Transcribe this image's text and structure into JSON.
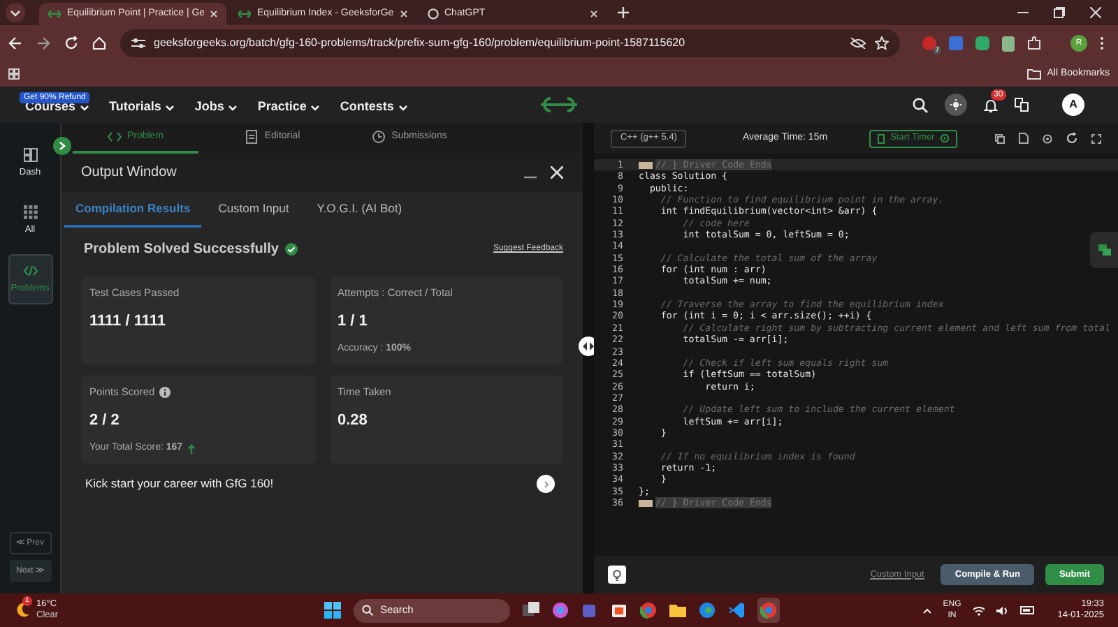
{
  "browser": {
    "tabs": [
      {
        "label": "Equilibrium Point | Practice | Ge",
        "selected": true
      },
      {
        "label": "Equilibrium Index - GeeksforGe",
        "selected": false
      },
      {
        "label": "ChatGPT",
        "selected": false
      }
    ],
    "url": "geeksforgeeks.org/batch/gfg-160-problems/track/prefix-sum-gfg-160/problem/equilibrium-point-1587115620",
    "extension_badge": "7",
    "profile_initial": "R",
    "bookmarks_label": "All Bookmarks"
  },
  "site_nav": {
    "promo_badge": "Get 90% Refund",
    "items": [
      "Courses",
      "Tutorials",
      "Jobs",
      "Practice",
      "Contests"
    ],
    "notification_count": "30",
    "avatar_initial": "A"
  },
  "sidebar": {
    "items": [
      {
        "label": "Dash",
        "selected": false
      },
      {
        "label": "All",
        "selected": false
      },
      {
        "label": "Problems",
        "selected": true
      }
    ],
    "prev": "≪ Prev",
    "next": "Next ≫"
  },
  "problem_tabs": [
    {
      "label": "Problem",
      "selected": true
    },
    {
      "label": "Editorial",
      "selected": false
    },
    {
      "label": "Submissions",
      "selected": false
    }
  ],
  "output_window": {
    "title": "Output Window",
    "tabs": [
      {
        "label": "Compilation Results",
        "selected": true
      },
      {
        "label": "Custom Input",
        "selected": false
      },
      {
        "label": "Y.O.G.I. (AI Bot)",
        "selected": false
      }
    ],
    "status": "Problem Solved Successfully",
    "feedback_link": "Suggest Feedback",
    "cards": [
      {
        "title": "Test Cases Passed",
        "value": "1111 / 1111"
      },
      {
        "title": "Attempts : Correct / Total",
        "value": "1 / 1",
        "note": "Accuracy : **100%**"
      },
      {
        "title": "Points Scored",
        "value": "2 / 2",
        "note": "Your Total Score: **167**",
        "info": true,
        "trend_up": true
      },
      {
        "title": "Time Taken",
        "value": "0.28"
      }
    ],
    "promo": "Kick start your career with GfG 160!"
  },
  "editor": {
    "language": "C++ (g++ 5.4)",
    "average_time": "Average Time: 15m",
    "timer_button": "Start Timer",
    "lines": [
      {
        "number": "1",
        "text": "// } Driver Code Ends",
        "kind": "folded"
      },
      {
        "number": "8",
        "text": "class Solution {",
        "kind": "code"
      },
      {
        "number": "9",
        "text": "  public:",
        "kind": "code"
      },
      {
        "number": "10",
        "text": "    // Function to find equilibrium point in the array.",
        "kind": "comment"
      },
      {
        "number": "11",
        "text": "    int findEquilibrium(vector<int> &arr) {",
        "kind": "code"
      },
      {
        "number": "12",
        "text": "        // code here",
        "kind": "comment"
      },
      {
        "number": "13",
        "text": "        int totalSum = 0, leftSum = 0;",
        "kind": "code"
      },
      {
        "number": "14",
        "kind": "code"
      },
      {
        "number": "15",
        "text": "    // Calculate the total sum of the array",
        "kind": "comment"
      },
      {
        "number": "16",
        "text": "    for (int num : arr)",
        "kind": "code"
      },
      {
        "number": "17",
        "text": "        totalSum += num;",
        "kind": "code"
      },
      {
        "number": "18",
        "kind": "code"
      },
      {
        "number": "19",
        "text": "    // Traverse the array to find the equilibrium index",
        "kind": "comment"
      },
      {
        "number": "20",
        "text": "    for (int i = 0; i < arr.size(); ++i) {",
        "kind": "code"
      },
      {
        "number": "21",
        "text": "        // Calculate right sum by subtracting current element and left sum from total",
        "kind": "comment"
      },
      {
        "number": "22",
        "text": "        totalSum -= arr[i];",
        "kind": "code"
      },
      {
        "number": "23",
        "kind": "code"
      },
      {
        "number": "24",
        "text": "        // Check if left sum equals right sum",
        "kind": "comment"
      },
      {
        "number": "25",
        "text": "        if (leftSum == totalSum)",
        "kind": "code"
      },
      {
        "number": "26",
        "text": "            return i;",
        "kind": "code"
      },
      {
        "number": "27",
        "kind": "code"
      },
      {
        "number": "28",
        "text": "        // Update left sum to include the current element",
        "kind": "comment"
      },
      {
        "number": "29",
        "text": "        leftSum += arr[i];",
        "kind": "code"
      },
      {
        "number": "30",
        "text": "    }",
        "kind": "code"
      },
      {
        "number": "31",
        "kind": "code"
      },
      {
        "number": "32",
        "text": "    // If no equilibrium index is found",
        "kind": "comment"
      },
      {
        "number": "33",
        "text": "    return -1;",
        "kind": "code"
      },
      {
        "number": "34",
        "text": "    }",
        "kind": "code"
      },
      {
        "number": "35",
        "text": "};",
        "kind": "code"
      },
      {
        "number": "36",
        "text": "// } Driver Code Ends",
        "kind": "folded"
      }
    ],
    "custom_input_link": "Custom Input",
    "compile_button": "Compile & Run",
    "submit_button": "Submit"
  },
  "taskbar": {
    "weather_badge": "1",
    "temperature": "16°C",
    "condition": "Clear",
    "search": "Search",
    "language": "ENG",
    "region": "IN",
    "time": "19:33",
    "date": "14-01-2025"
  }
}
